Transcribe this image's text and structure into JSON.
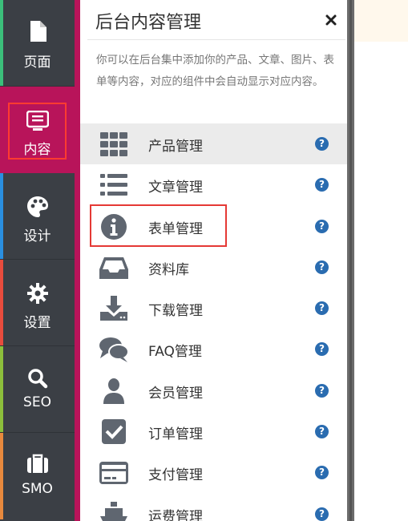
{
  "sidebar": {
    "items": [
      {
        "label": "页面",
        "icon": "page-icon",
        "accent": "#3bbf7a"
      },
      {
        "label": "内容",
        "icon": "content-icon",
        "accent": "#b8145a",
        "active": true
      },
      {
        "label": "设计",
        "icon": "palette-icon",
        "accent": "#2a8fe0"
      },
      {
        "label": "设置",
        "icon": "gear-icon",
        "accent": "#e84c3d"
      },
      {
        "label": "SEO",
        "icon": "search-icon",
        "accent": "#8cbf3b"
      },
      {
        "label": "SMO",
        "icon": "briefcase-icon",
        "accent": "#e8893d"
      }
    ]
  },
  "panel": {
    "title": "后台内容管理",
    "close": "×",
    "description": "你可以在后台集中添加你的产品、文章、图片、表单等内容，对应的组件中会自动显示对应内容。",
    "items": [
      {
        "label": "产品管理",
        "icon": "grid-icon"
      },
      {
        "label": "文章管理",
        "icon": "list-icon"
      },
      {
        "label": "表单管理",
        "icon": "info-icon"
      },
      {
        "label": "资料库",
        "icon": "inbox-icon"
      },
      {
        "label": "下载管理",
        "icon": "download-icon"
      },
      {
        "label": "FAQ管理",
        "icon": "comments-icon"
      },
      {
        "label": "会员管理",
        "icon": "user-icon"
      },
      {
        "label": "订单管理",
        "icon": "checkbox-icon"
      },
      {
        "label": "支付管理",
        "icon": "credit-card-icon"
      },
      {
        "label": "运费管理",
        "icon": "ship-icon"
      }
    ],
    "help": "?"
  },
  "colors": {
    "sidebar_bg": "#3b3f45",
    "active_bg": "#b8145a",
    "help_blue": "#2a6cb0",
    "icon_gray": "#5f6670",
    "highlight_box": "#e53935"
  }
}
